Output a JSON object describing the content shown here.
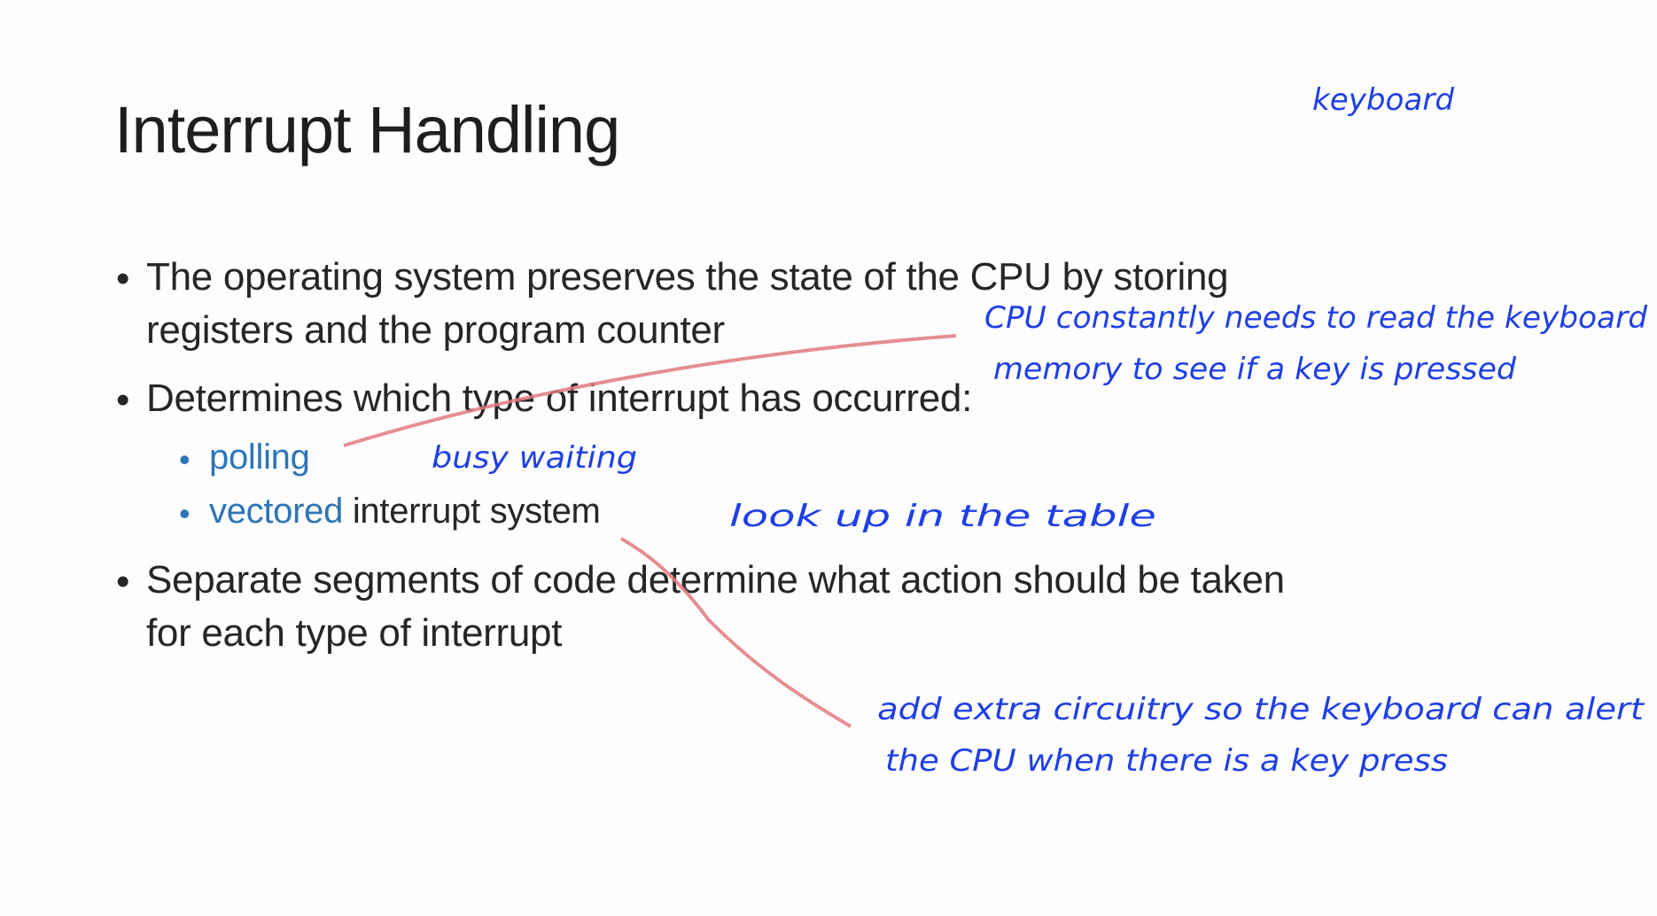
{
  "slide": {
    "title": "Interrupt Handling",
    "bullets": [
      {
        "lines": [
          "The operating system preserves the state of the CPU by storing",
          "registers and the program counter"
        ]
      },
      {
        "lines": [
          "Determines which type of interrupt has occurred:"
        ],
        "subitems": [
          {
            "highlight": "polling",
            "rest": ""
          },
          {
            "highlight": "vectored",
            "rest": " interrupt system"
          }
        ]
      },
      {
        "lines": [
          "Separate segments of code determine what action should be taken",
          "for each type of interrupt"
        ]
      }
    ],
    "bullet_glyph": "•"
  },
  "annotations": {
    "keyboard": "keyboard",
    "polling_note_1": "CPU constantly needs to read the keyboard",
    "polling_note_2": "memory to see if a key is pressed",
    "busy_waiting": "busy waiting",
    "look_up": "look up in the table",
    "vectored_note_1": "add extra circuitry so the keyboard can alert",
    "vectored_note_2": "the CPU when there is a key press"
  },
  "colors": {
    "text": "#262626",
    "accent_blue": "#2e75b6",
    "ink_blue": "#1f3fe6",
    "ink_red": "#e07a80"
  }
}
